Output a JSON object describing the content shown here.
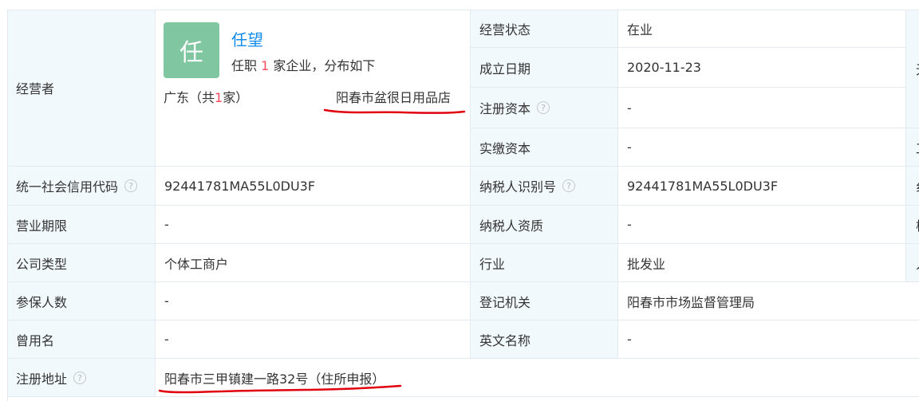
{
  "operator": {
    "label": "经营者",
    "avatar_char": "任",
    "name": "任望",
    "desc_prefix": "任职 ",
    "desc_count": "1",
    "desc_suffix": " 家企业，分布如下",
    "region_prefix": "广东（共",
    "region_count": "1",
    "region_suffix": "家）",
    "shop": "阳春市盆很日用品店"
  },
  "right_top": [
    {
      "label": "经营状态",
      "value": "在业"
    },
    {
      "label": "成立日期",
      "value": "2020-11-23"
    },
    {
      "label": "注册资本",
      "value": "-"
    },
    {
      "label": "实缴资本",
      "value": "-"
    }
  ],
  "rows": [
    {
      "left_label": "统一社会信用代码",
      "left_value": "92441781MA55L0DU3F",
      "right_label": "纳税人识别号",
      "right_value": "92441781MA55L0DU3F"
    },
    {
      "left_label": "营业期限",
      "left_value": "-",
      "right_label": "纳税人资质",
      "right_value": "-"
    },
    {
      "left_label": "公司类型",
      "left_value": "个体工商户",
      "right_label": "行业",
      "right_value": "批发业"
    },
    {
      "left_label": "参保人数",
      "left_value": "-",
      "right_label": "登记机关",
      "right_value": "阳春市市场监督管理局"
    },
    {
      "left_label": "曾用名",
      "left_value": "-",
      "right_label": "英文名称",
      "right_value": "-"
    }
  ],
  "address": {
    "label": "注册地址",
    "value": "阳春市三甲镇建一路32号（住所申报）"
  },
  "edge_chars": [
    "无",
    "工",
    "纟",
    "椅",
    "人"
  ],
  "colors": {
    "label_bg": "#f2f9fc",
    "link": "#128bed",
    "accent_red": "#fd485e",
    "annotation": "#e0000e"
  },
  "icons": {
    "help": "help-circle-icon"
  }
}
